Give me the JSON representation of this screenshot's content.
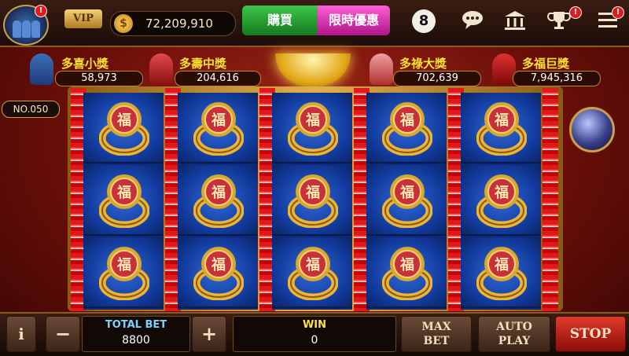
{
  "topbar": {
    "vip_label": "VIP",
    "coins": "72,209,910",
    "buy_label": "購買",
    "promo_label": "限時優惠",
    "eight_ball": "8",
    "badge": "!"
  },
  "jackpots": [
    {
      "title": "多喜小獎",
      "value": "58,973"
    },
    {
      "title": "多壽中獎",
      "value": "204,616"
    },
    {
      "title": "多祿大獎",
      "value": "702,639"
    },
    {
      "title": "多福巨獎",
      "value": "7,945,316"
    }
  ],
  "reel_number": "NO.050",
  "reels": {
    "symbol": "ring-fu-icon",
    "symbol_char": "福",
    "columns": 5,
    "rows": 3
  },
  "bottom": {
    "info_label": "i",
    "minus_label": "−",
    "plus_label": "+",
    "total_bet_label": "TOTAL BET",
    "total_bet_value": "8800",
    "win_label": "WIN",
    "win_value": "0",
    "max_bet_line1": "MAX",
    "max_bet_line2": "BET",
    "auto_play_line1": "AUTO",
    "auto_play_line2": "PLAY",
    "stop_label": "STOP"
  },
  "colors": {
    "background": "#7a1409",
    "reel_blue": "#123a9c",
    "gold": "#e2b04a",
    "jackpot_text": "#ffdf3a",
    "buy_green": "#1f9a2a",
    "promo_pink": "#d61fae"
  }
}
